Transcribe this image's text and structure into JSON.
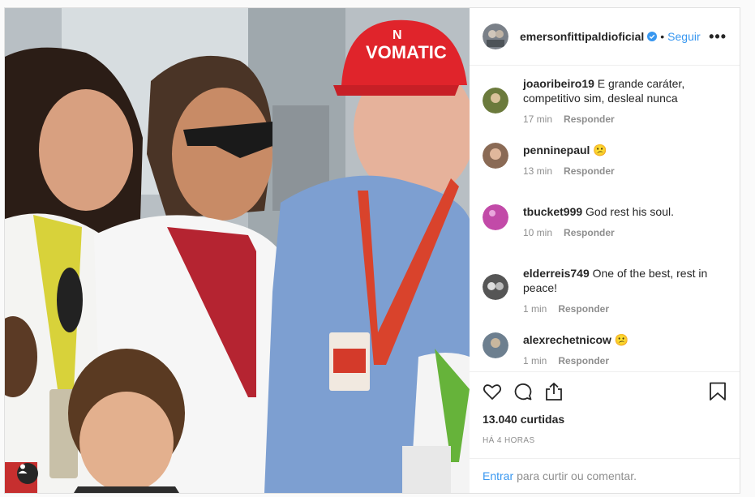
{
  "header": {
    "username": "emersonfittipaldioficial",
    "separator": "•",
    "follow_label": "Seguir",
    "more_label": "•••"
  },
  "comments": [
    {
      "user": "joaoribeiro19",
      "text": " E grande caráter, competitivo sim, desleal nunca",
      "time": "17 min",
      "reply": "Responder",
      "avatar_color": "#6b7a3c"
    },
    {
      "user": "penninepaul",
      "text": " 😕",
      "time": "13 min",
      "reply": "Responder",
      "avatar_color": "#8a6a55"
    },
    {
      "user": "tbucket999",
      "text": " God rest his soul.",
      "time": "10 min",
      "reply": "Responder",
      "avatar_color": "#c24aa8"
    },
    {
      "user": "elderreis749",
      "text": " One of the best, rest in peace!",
      "time": "1 min",
      "reply": "Responder",
      "avatar_color": "#555555"
    },
    {
      "user": "alexrechetnicow",
      "text": " 😕",
      "time": "1 min",
      "reply": "Responder",
      "avatar_color": "#6d7f8f"
    }
  ],
  "likes": "13.040 curtidas",
  "timestamp": "HÁ 4 HORAS",
  "footer": {
    "login_label": "Entrar",
    "rest_label": "para curtir ou comentar."
  },
  "photo": {
    "cap_logo": "VOMATIC",
    "cap_letter": "N"
  },
  "colors": {
    "accent": "#3897f0",
    "muted": "#8e8e8e",
    "cap_red": "#e0242b"
  },
  "icons": [
    "like-icon",
    "comment-icon",
    "share-icon",
    "bookmark-icon",
    "verified-icon",
    "user-tag-icon",
    "more-options-icon"
  ]
}
